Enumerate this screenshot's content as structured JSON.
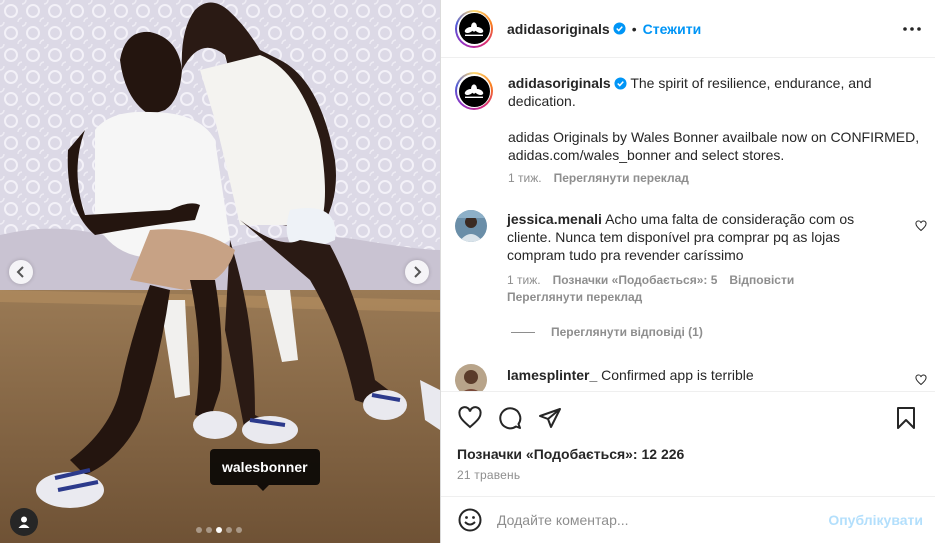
{
  "media": {
    "tag_label": "walesbonner",
    "prev_icon": "chevron-left-icon",
    "next_icon": "chevron-right-icon",
    "user_tag_icon": "user-icon",
    "carousel": {
      "count": 5,
      "active_index": 2
    }
  },
  "header": {
    "username": "adidasoriginals",
    "separator": "•",
    "follow_label": "Стежити",
    "more_icon": "more-horizontal-icon"
  },
  "caption": {
    "username": "adidasoriginals",
    "line1": "The spirit of resilience, endurance, and dedication.",
    "line2": "adidas Originals by Wales Bonner availbale now on CONFIRMED, adidas.com/wales_bonner and select stores.",
    "time": "1 тиж.",
    "translate": "Переглянути переклад"
  },
  "comments": [
    {
      "username": "jessica.menali",
      "text": "Acho uma falta de consideração com os cliente. Nunca tem disponível pra comprar pq as lojas compram tudo pra revender caríssimo",
      "time": "1 тиж.",
      "likes": "Позначки «Подобається»: 5",
      "reply": "Відповісти",
      "translate": "Переглянути переклад",
      "view_replies": "Переглянути відповіді (1)"
    },
    {
      "username": "lamesplinter_",
      "text": "Confirmed app is terrible"
    }
  ],
  "actions": {
    "like_icon": "heart-icon",
    "comment_icon": "comment-icon",
    "share_icon": "send-icon",
    "save_icon": "bookmark-icon"
  },
  "likes_text": "Позначки «Подобається»: 12 226",
  "date": "21 травень",
  "composer": {
    "emoji_icon": "emoji-icon",
    "placeholder": "Додайте коментар...",
    "post_label": "Опублікувати"
  },
  "colors": {
    "accent": "#0095f6",
    "post_disabled": "#b3dffc",
    "muted": "#8e8e8e"
  }
}
